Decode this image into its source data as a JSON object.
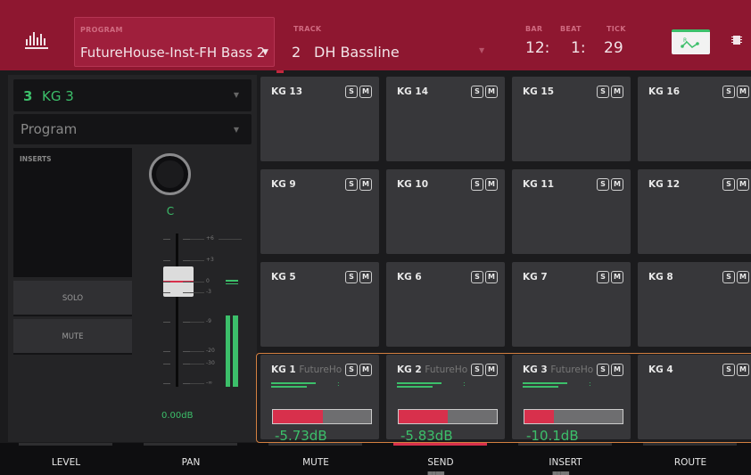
{
  "header": {
    "program_caption": "PROGRAM",
    "program_name": "FutureHouse-Inst-FH Bass 2",
    "track_caption": "TRACK",
    "track_number": "2",
    "track_name": "DH Bassline",
    "bar_caption": "BAR",
    "beat_caption": "BEAT",
    "tick_caption": "TICK",
    "bar": "12:",
    "beat": "1:",
    "tick": "29",
    "accent_color": "#8e1730"
  },
  "left_panel": {
    "pad_number": "3",
    "pad_name": "KG 3",
    "program_select": "Program",
    "inserts_label": "INSERTS",
    "solo_label": "SOLO",
    "mute_label": "MUTE",
    "pan_value": "C",
    "volume_value": "0.00dB",
    "db_labels": [
      "+6",
      "+3",
      "0",
      "-3",
      "-9",
      "-20",
      "-30",
      "-∞"
    ]
  },
  "pads": [
    {
      "name": "KG 13",
      "sub": ""
    },
    {
      "name": "KG 14",
      "sub": ""
    },
    {
      "name": "KG 15",
      "sub": ""
    },
    {
      "name": "KG 16",
      "sub": ""
    },
    {
      "name": "KG 9",
      "sub": ""
    },
    {
      "name": "KG 10",
      "sub": ""
    },
    {
      "name": "KG 11",
      "sub": ""
    },
    {
      "name": "KG 12",
      "sub": ""
    },
    {
      "name": "KG 5",
      "sub": ""
    },
    {
      "name": "KG 6",
      "sub": ""
    },
    {
      "name": "KG 7",
      "sub": ""
    },
    {
      "name": "KG 8",
      "sub": ""
    },
    {
      "name": "KG 1",
      "sub": "FutureHo",
      "db": "-5.73dB",
      "level": 0.51
    },
    {
      "name": "KG 2",
      "sub": "FutureHo",
      "db": "-5.83dB",
      "level": 0.5
    },
    {
      "name": "KG 3",
      "sub": "FutureHo",
      "db": "-10.1dB",
      "level": 0.3
    },
    {
      "name": "KG 4",
      "sub": ""
    }
  ],
  "solo_letter": "S",
  "mute_letter": "M",
  "tabs": [
    "LEVEL",
    "PAN",
    "MUTE",
    "SEND",
    "INSERT",
    "ROUTE"
  ],
  "active_tab": "SEND",
  "colors": {
    "green": "#3cbf6a",
    "red": "#d8304c",
    "orange": "#d37f40"
  }
}
